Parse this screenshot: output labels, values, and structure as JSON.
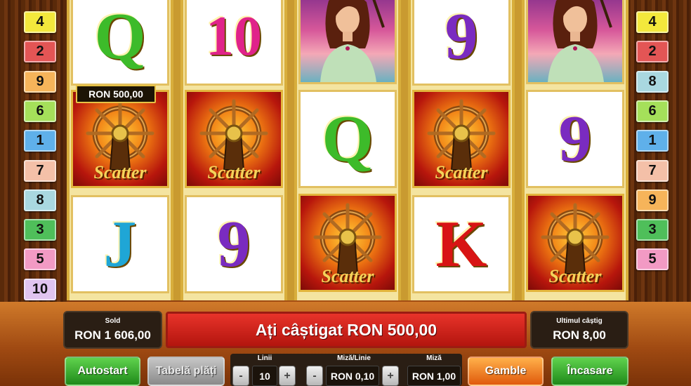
{
  "paylines_left": [
    {
      "label": "4",
      "color": "#f3e83c"
    },
    {
      "label": "2",
      "color": "#e35555"
    },
    {
      "label": "9",
      "color": "#f6b45a"
    },
    {
      "label": "6",
      "color": "#a5e05a"
    },
    {
      "label": "1",
      "color": "#5fb0ea"
    },
    {
      "label": "7",
      "color": "#f4c0a8"
    },
    {
      "label": "8",
      "color": "#a9d8e0"
    },
    {
      "label": "3",
      "color": "#4fbf5a"
    },
    {
      "label": "5",
      "color": "#f29ac4"
    },
    {
      "label": "10",
      "color": "#e0c4f0"
    }
  ],
  "paylines_right": [
    {
      "label": "4",
      "color": "#f3e83c"
    },
    {
      "label": "2",
      "color": "#e35555"
    },
    {
      "label": "8",
      "color": "#a9d8e0"
    },
    {
      "label": "6",
      "color": "#a5e05a"
    },
    {
      "label": "1",
      "color": "#5fb0ea"
    },
    {
      "label": "7",
      "color": "#f4c0a8"
    },
    {
      "label": "9",
      "color": "#f6b45a"
    },
    {
      "label": "3",
      "color": "#4fbf5a"
    },
    {
      "label": "5",
      "color": "#f29ac4"
    }
  ],
  "reels": [
    [
      "Q",
      "scatter",
      "J"
    ],
    [
      "10",
      "scatter",
      "9"
    ],
    [
      "lady",
      "Q",
      "scatter"
    ],
    [
      "9",
      "scatter",
      "K"
    ],
    [
      "lady",
      "9",
      "scatter"
    ]
  ],
  "symbol_colors": {
    "Q": "#3dbb2a",
    "J": "#1fa6d6",
    "10": "#e0238a",
    "9": "#7a2bc0",
    "K": "#d81414"
  },
  "scatter_text": "Scatter",
  "win_tag": "RON 500,00",
  "balance": {
    "label": "Sold",
    "value": "RON 1 606,00"
  },
  "message": "Ați câștigat RON 500,00",
  "last_win": {
    "label": "Ultimul câștig",
    "value": "RON 8,00"
  },
  "buttons": {
    "autostart": "Autostart",
    "paytable": "Tabelă plăți",
    "gamble": "Gamble",
    "collect": "Încasare"
  },
  "controls": {
    "lines_label": "Linii",
    "lines_value": "10",
    "bet_line_label": "Miză/Linie",
    "bet_line_value": "RON 0,10",
    "bet_label": "Miză",
    "bet_value": "RON 1,00",
    "minus": "-",
    "plus": "+"
  }
}
